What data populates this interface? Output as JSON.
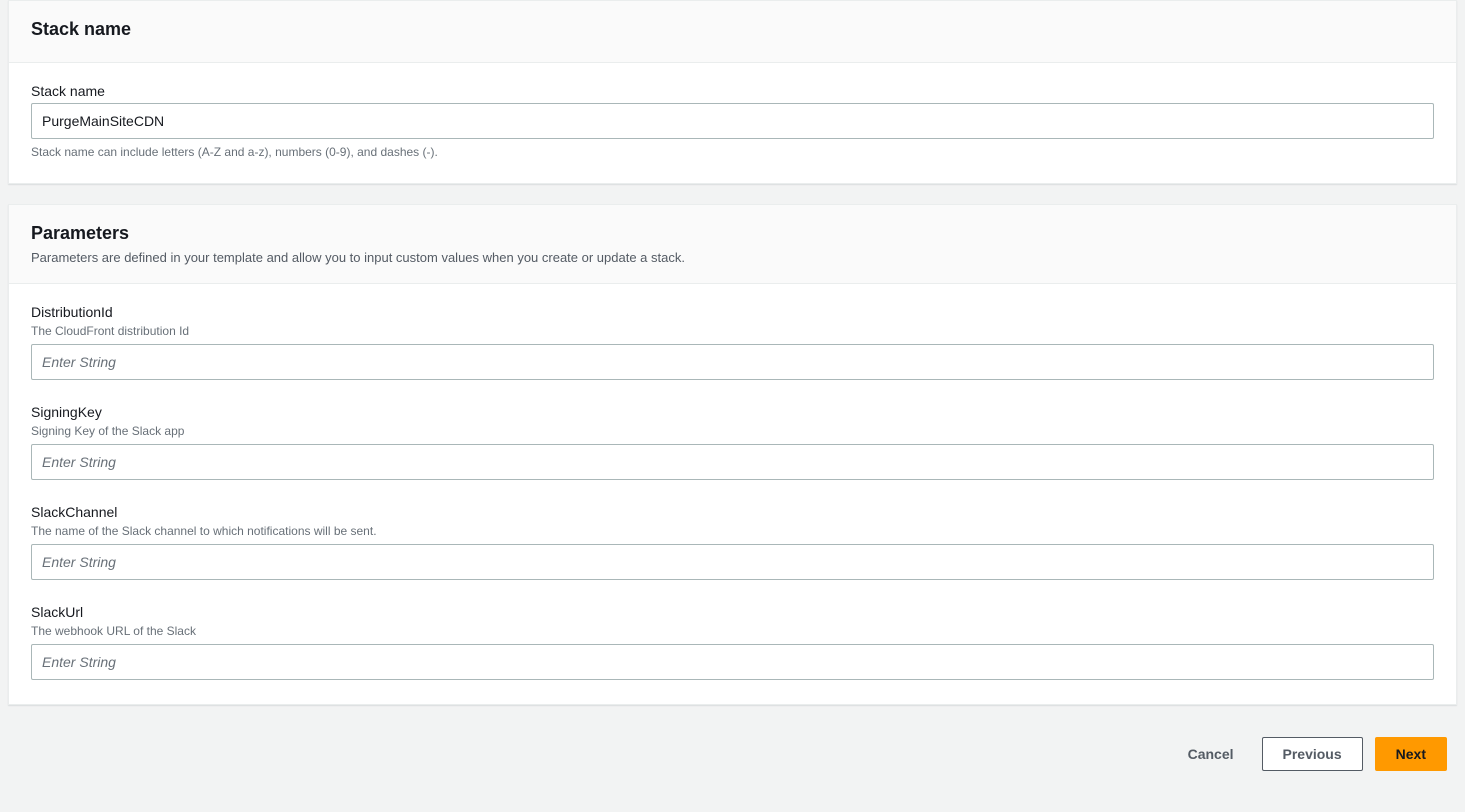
{
  "stackNameSection": {
    "heading": "Stack name",
    "label": "Stack name",
    "value": "PurgeMainSiteCDN",
    "hint": "Stack name can include letters (A-Z and a-z), numbers (0-9), and dashes (-)."
  },
  "parametersSection": {
    "heading": "Parameters",
    "subtitle": "Parameters are defined in your template and allow you to input custom values when you create or update a stack.",
    "fields": [
      {
        "label": "DistributionId",
        "description": "The CloudFront distribution Id",
        "placeholder": "Enter String",
        "value": ""
      },
      {
        "label": "SigningKey",
        "description": "Signing Key of the Slack app",
        "placeholder": "Enter String",
        "value": ""
      },
      {
        "label": "SlackChannel",
        "description": "The name of the Slack channel to which notifications will be sent.",
        "placeholder": "Enter String",
        "value": ""
      },
      {
        "label": "SlackUrl",
        "description": "The webhook URL of the Slack",
        "placeholder": "Enter String",
        "value": ""
      }
    ]
  },
  "buttons": {
    "cancel": "Cancel",
    "previous": "Previous",
    "next": "Next"
  }
}
